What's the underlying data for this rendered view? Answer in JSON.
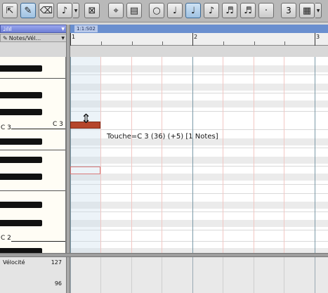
{
  "toolbar": {
    "tools": [
      {
        "name": "select-tool",
        "icon": "arrow-select-icon",
        "glyph": "⇱"
      },
      {
        "name": "draw-tool",
        "icon": "pencil-icon",
        "glyph": "✎",
        "active": true
      },
      {
        "name": "erase-tool",
        "icon": "eraser-icon",
        "glyph": "⌫"
      },
      {
        "name": "paint-tool",
        "icon": "brush-icon",
        "glyph": "♪"
      },
      {
        "name": "mute-tool",
        "icon": "mute-icon",
        "glyph": "⊠"
      },
      {
        "name": "quantize-tool",
        "icon": "quantize-icon",
        "glyph": "⌖"
      },
      {
        "name": "grid-tool",
        "icon": "ruler-icon",
        "glyph": "▤"
      },
      {
        "name": "whole-note",
        "icon": "whole-note-icon",
        "glyph": "○"
      },
      {
        "name": "half-note",
        "icon": "half-note-icon",
        "glyph": "♩"
      },
      {
        "name": "quarter-note",
        "icon": "quarter-note-icon",
        "glyph": "♩",
        "active": true
      },
      {
        "name": "eighth-note",
        "icon": "eighth-note-icon",
        "glyph": "♪"
      },
      {
        "name": "sixteenth-note",
        "icon": "sixteenth-note-icon",
        "glyph": "♬"
      },
      {
        "name": "thirtysecond-note",
        "icon": "thirtysecond-note-icon",
        "glyph": "♬"
      },
      {
        "name": "dotted",
        "icon": "dot-icon",
        "glyph": "·"
      }
    ],
    "tuplet_value": "3",
    "grid_icon": "grid-icon"
  },
  "lane_select": {
    "label": "♩ılıl",
    "sub_label": "Notes/Vél..."
  },
  "ruler": {
    "position": "1:1:S02",
    "bars": [
      "1",
      "2",
      "3"
    ]
  },
  "keyboard": {
    "labels": [
      "C 3",
      "C 2"
    ],
    "row_label": "C 3"
  },
  "grid": {
    "tooltip": "Touche=C 3 (36) (+5) [1 Notes]"
  },
  "velocity": {
    "label": "Vélocité",
    "max": "127",
    "mid": "96"
  },
  "colors": {
    "note": "#b5462b",
    "ruler_bar": "#6a8fcf",
    "selector": "#7f8ee0"
  }
}
